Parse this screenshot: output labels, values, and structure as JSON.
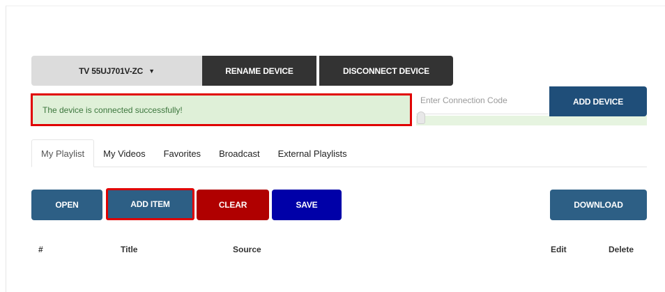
{
  "device_bar": {
    "selected_device": "TV 55UJ701V-ZC",
    "rename_label": "RENAME DEVICE",
    "disconnect_label": "DISCONNECT DEVICE"
  },
  "status": {
    "message": "The device is connected successfully!"
  },
  "connection": {
    "placeholder": "Enter Connection Code",
    "value": "",
    "add_label": "ADD DEVICE"
  },
  "tabs": [
    {
      "label": "My Playlist",
      "active": true
    },
    {
      "label": "My Videos",
      "active": false
    },
    {
      "label": "Favorites",
      "active": false
    },
    {
      "label": "Broadcast",
      "active": false
    },
    {
      "label": "External Playlists",
      "active": false
    }
  ],
  "actions": {
    "open": "OPEN",
    "add_item": "ADD ITEM",
    "clear": "CLEAR",
    "save": "SAVE",
    "download": "DOWNLOAD"
  },
  "table": {
    "headers": [
      "#",
      "Title",
      "Source",
      "Edit",
      "Delete"
    ]
  },
  "colors": {
    "dark_button": "#333333",
    "primary_blue": "#2d5f85",
    "navy": "#1f4e79",
    "clear_red": "#b00000",
    "save_blue": "#0000a8",
    "success_bg": "#dff0d8",
    "highlight_red": "#e00000"
  }
}
